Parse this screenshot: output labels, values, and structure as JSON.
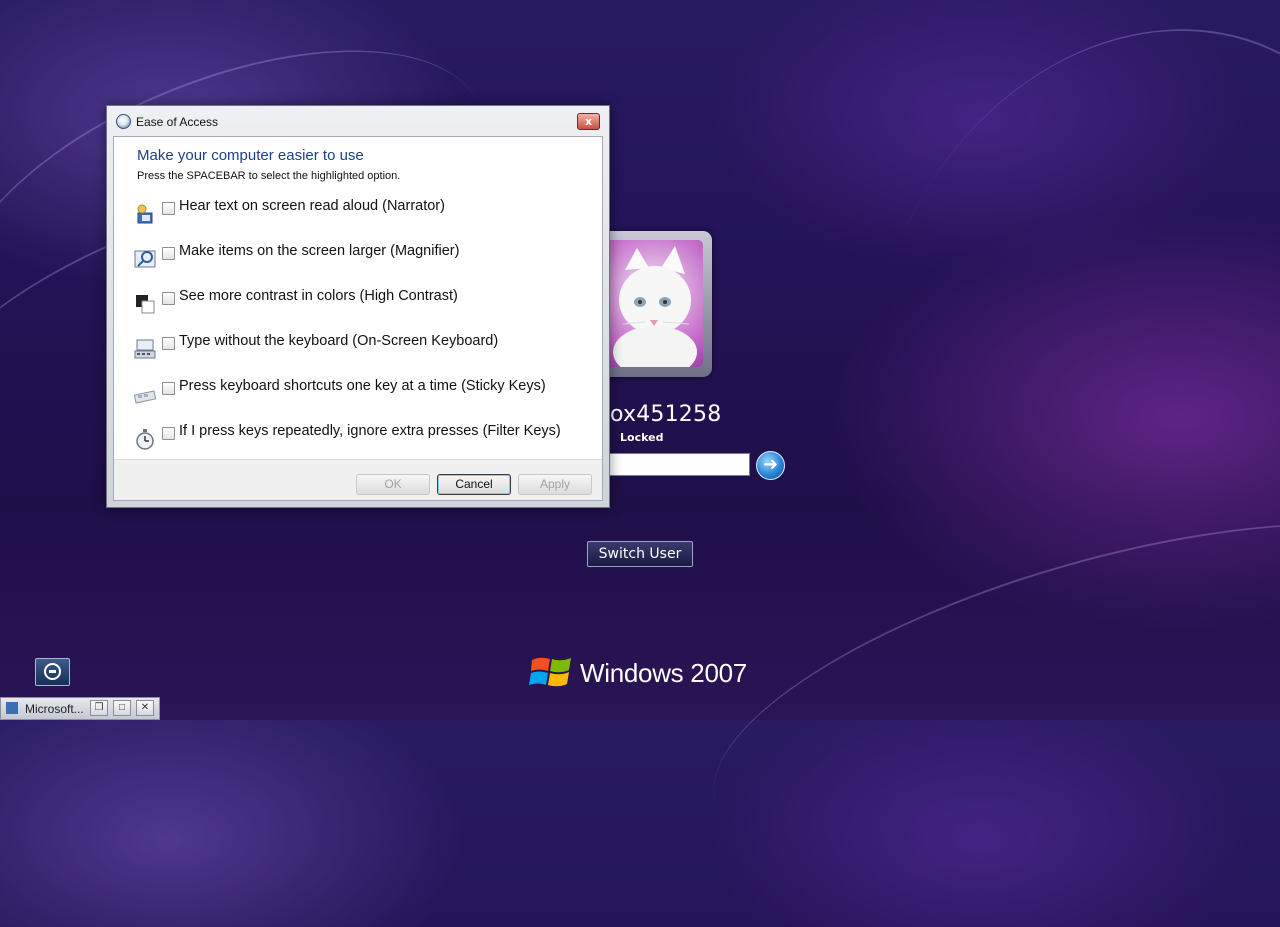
{
  "dialog": {
    "title": "Ease of Access",
    "heading": "Make your computer easier to use",
    "subtext": "Press the SPACEBAR to select the highlighted option.",
    "close_label": "x",
    "options": [
      {
        "label": "Hear text on screen read aloud (Narrator)",
        "icon": "narrator-icon",
        "checked": false
      },
      {
        "label": "Make items on the screen larger (Magnifier)",
        "icon": "magnifier-icon",
        "checked": false
      },
      {
        "label": "See more contrast in colors (High Contrast)",
        "icon": "high-contrast-icon",
        "checked": false
      },
      {
        "label": "Type without the keyboard (On-Screen Keyboard)",
        "icon": "on-screen-keyboard-icon",
        "checked": false
      },
      {
        "label": "Press keyboard shortcuts one key at a time (Sticky Keys)",
        "icon": "sticky-keys-icon",
        "checked": false
      },
      {
        "label": "If I press keys repeatedly, ignore extra presses (Filter Keys)",
        "icon": "filter-keys-icon",
        "checked": false
      }
    ],
    "buttons": {
      "ok": "OK",
      "cancel": "Cancel",
      "apply": "Apply"
    }
  },
  "logon": {
    "username": "ox451258",
    "status": "Locked",
    "password_value": "",
    "submit_icon": "arrow-right-icon",
    "switch_user": "Switch User",
    "brand": "Windows 2007",
    "ease_icon": "ease-of-access-icon"
  },
  "taskbar": {
    "minimized_title": "Microsoft...",
    "restore_icon": "restore-icon",
    "maximize_icon": "maximize-icon",
    "close_icon": "close-icon"
  },
  "colors": {
    "background": "#241357",
    "heading": "#1e3f88",
    "accent": "#2a86d6"
  }
}
